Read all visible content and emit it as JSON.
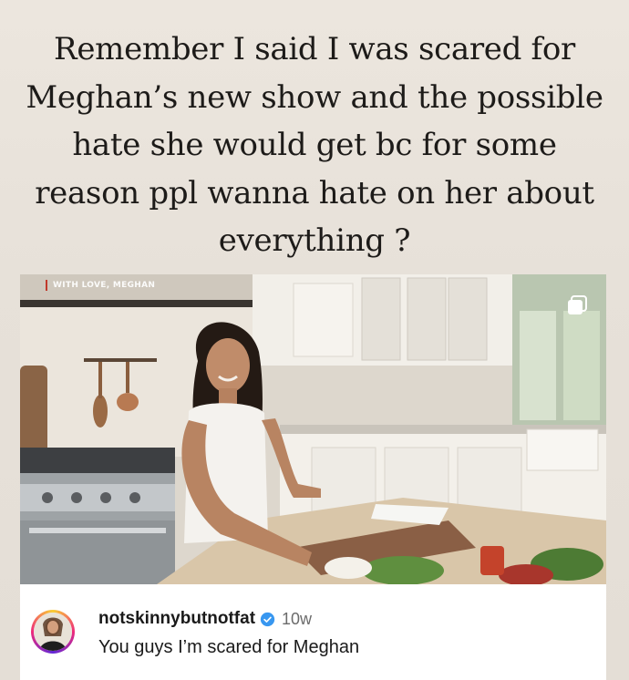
{
  "story": {
    "headline": "Remember I said I was scared for Meghan’s new show and the possible hate she would get bc for some reason ppl wanna hate on her about everything ?"
  },
  "post": {
    "watermark": "WITH LOVE, MEGHAN",
    "username": "notskinnybutnotfat",
    "verified_icon": "verified-badge-icon",
    "age": "10w",
    "caption": "You guys I’m scared for Meghan",
    "multi_media_icon": "carousel-icon"
  },
  "colors": {
    "background": "#e7e1d9",
    "verified": "#3897f0",
    "watermark_accent": "#c0392b"
  }
}
